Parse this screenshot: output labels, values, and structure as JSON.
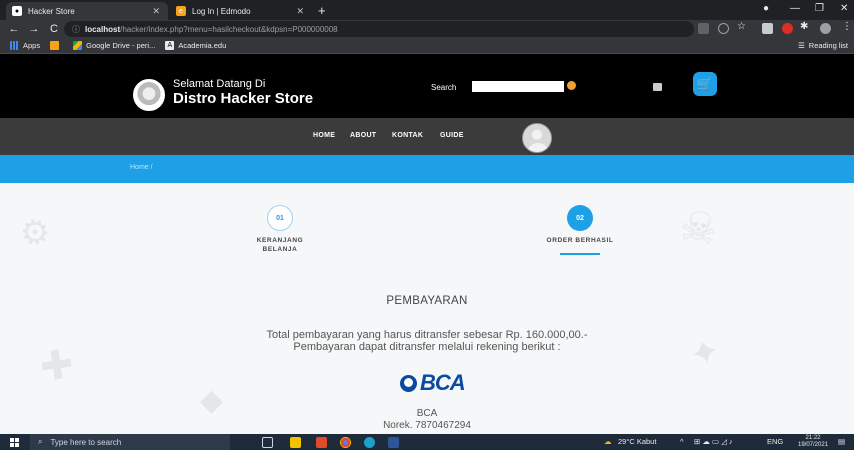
{
  "browser": {
    "tabs": [
      {
        "title": "Hacker Store",
        "active": true
      },
      {
        "title": "Log In | Edmodo",
        "active": false
      }
    ],
    "url_scheme_icon": "info-icon",
    "url_host": "localhost",
    "url_path": "/hacker/index.php?menu=hasilcheckout&kdpsn=P000000008",
    "bookmarks": [
      "Apps",
      "Google Drive - peri...",
      "Academia.edu"
    ],
    "reading_list": "Reading list"
  },
  "site": {
    "brand_top": "Selamat Datang Di",
    "brand_main": "Distro Hacker Store",
    "search_label": "Search",
    "search_value": "",
    "nav": [
      "HOME",
      "ABOUT",
      "KONTAK",
      "GUIDE"
    ],
    "breadcrumb": "Home  /"
  },
  "steps": [
    {
      "number": "01",
      "label_line1": "KERANJANG",
      "label_line2": "BELANJA",
      "active": false
    },
    {
      "number": "02",
      "label_line1": "ORDER BERHASIL",
      "label_line2": "",
      "active": true
    }
  ],
  "payment": {
    "title": "PEMBAYARAN",
    "line1": "Total pembayaran yang harus ditransfer sebesar Rp. 160.000,00.-",
    "line2": "Pembayaran dapat ditransfer melalui rekening berikut :",
    "bank_logo": "BCA",
    "bank_name": "BCA",
    "account": "Norek. 7870467294"
  },
  "taskbar": {
    "search_placeholder": "Type here to search",
    "weather": "29°C  Kabut",
    "language": "ENG",
    "time": "21:22",
    "date": "19/07/2021"
  },
  "colors": {
    "accent": "#1ea0e6",
    "header_bg": "#000000",
    "nav_bg": "#3b3b3b",
    "bca_blue": "#0a4aa0"
  }
}
